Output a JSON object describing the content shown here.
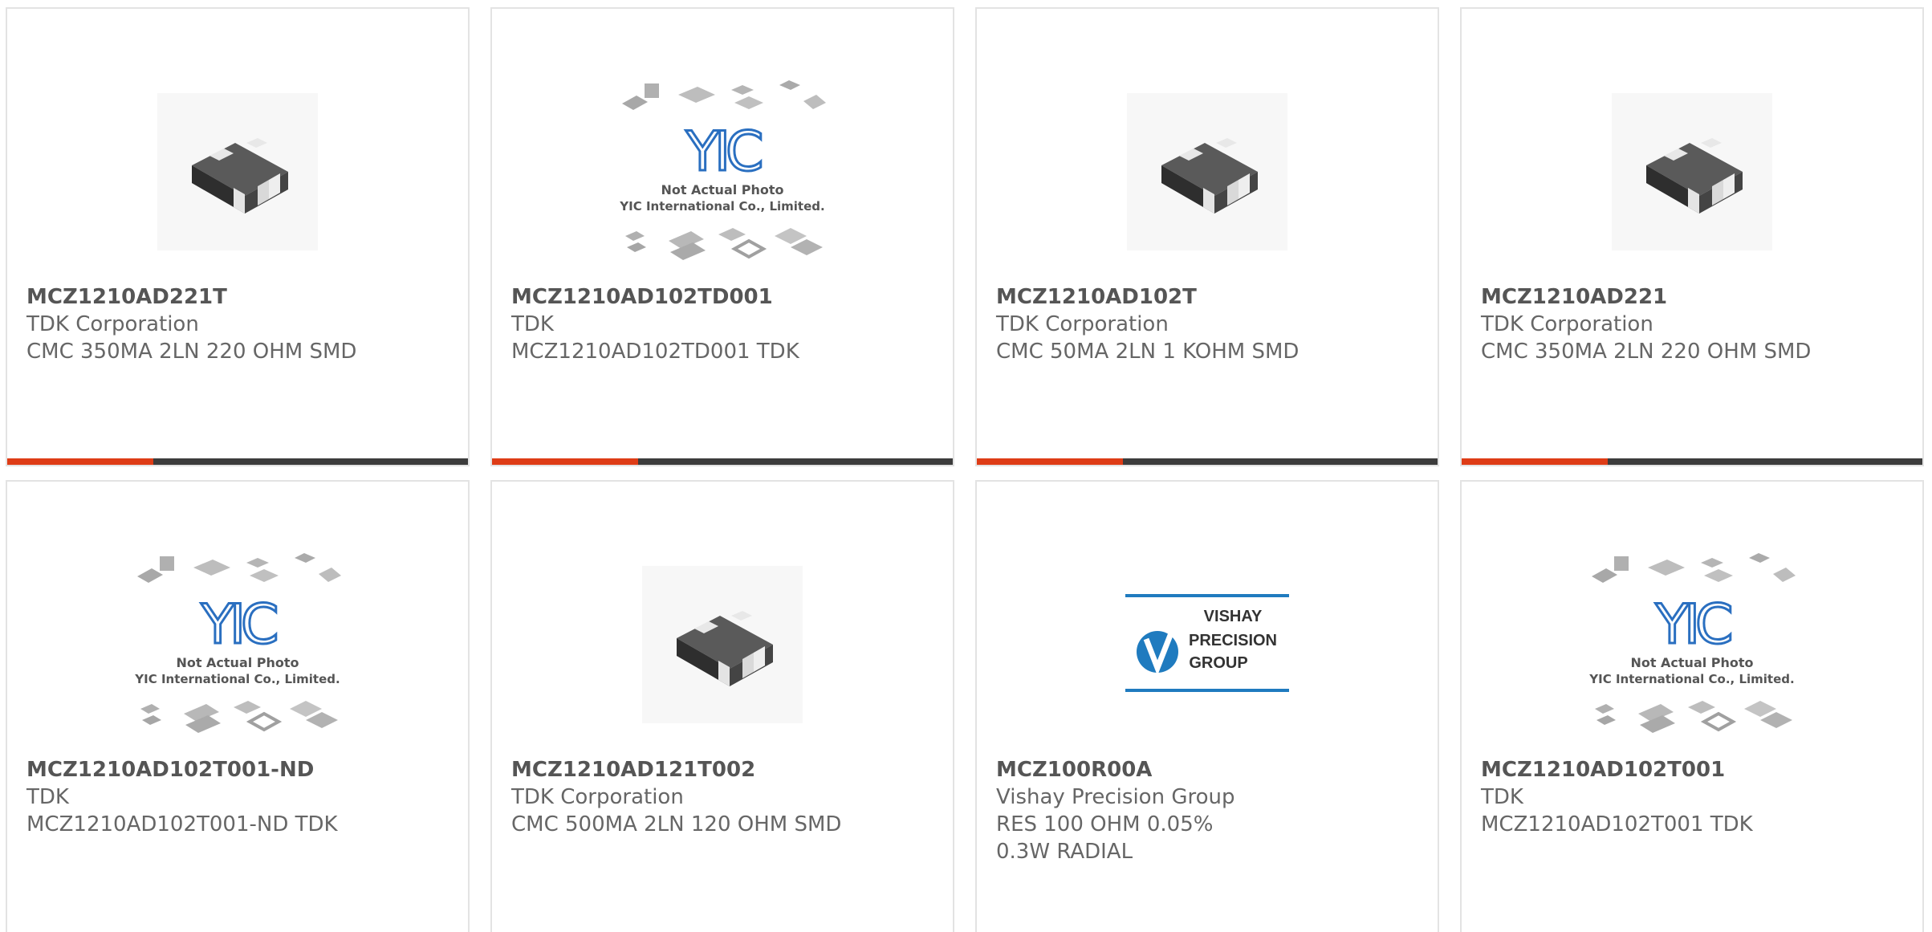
{
  "products": [
    {
      "part_number": "MCZ1210AD221T",
      "manufacturer": "TDK Corporation",
      "description": "CMC 350MA 2LN 220 OHM SMD",
      "image": "chip-photo"
    },
    {
      "part_number": "MCZ1210AD102TD001",
      "manufacturer": "TDK",
      "description": "MCZ1210AD102TD001 TDK",
      "image": "yic-placeholder"
    },
    {
      "part_number": "MCZ1210AD102T",
      "manufacturer": "TDK Corporation",
      "description": "CMC 50MA 2LN 1 KOHM SMD",
      "image": "chip-photo"
    },
    {
      "part_number": "MCZ1210AD221",
      "manufacturer": "TDK Corporation",
      "description": "CMC 350MA 2LN 220 OHM SMD",
      "image": "chip-photo"
    },
    {
      "part_number": "MCZ1210AD102T001-ND",
      "manufacturer": "TDK",
      "description": "MCZ1210AD102T001-ND TDK",
      "image": "yic-placeholder"
    },
    {
      "part_number": "MCZ1210AD121T002",
      "manufacturer": "TDK Corporation",
      "description": "CMC 500MA 2LN 120 OHM SMD",
      "image": "chip-photo"
    },
    {
      "part_number": "MCZ100R00A",
      "manufacturer": "Vishay Precision Group",
      "description": "RES 100 OHM 0.05% 0.3W RADIAL",
      "image": "vishay-logo"
    },
    {
      "part_number": "MCZ1210AD102T001",
      "manufacturer": "TDK",
      "description": "MCZ1210AD102T001 TDK",
      "image": "yic-placeholder"
    }
  ],
  "yic": {
    "line1": "Not Actual Photo",
    "line2": "YIC International Co., Limited."
  },
  "vishay": {
    "line1": "VISHAY",
    "line2": "PRECISION",
    "line3": "GROUP"
  },
  "colors": {
    "accent": "#de3c16",
    "bar": "#3c3c3c",
    "yic_blue": "#2a6fc0",
    "vishay_blue": "#1f7bbf"
  }
}
